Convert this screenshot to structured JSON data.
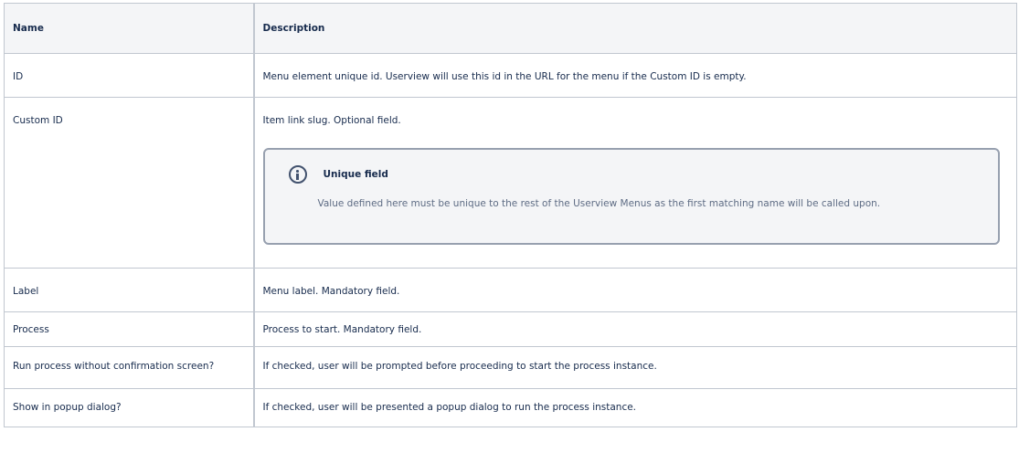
{
  "table": {
    "headers": {
      "name": "Name",
      "description": "Description"
    },
    "rows": [
      {
        "name": "ID",
        "description": "Menu element unique id. Userview will use this id in the URL for the menu if the Custom ID is empty."
      },
      {
        "name": "Custom ID",
        "description": "Item link slug. Optional field.",
        "panel": {
          "icon": "info-icon",
          "title": "Unique field",
          "body": "Value defined here must be unique to the rest of the Userview Menus as the first matching name will be called upon."
        }
      },
      {
        "name": "Label",
        "description": "Menu label. Mandatory field."
      },
      {
        "name": "Process",
        "description": "Process to start. Mandatory field."
      },
      {
        "name": "Run process without confirmation screen?",
        "description": "If checked, user will be prompted before proceeding to start the process instance."
      },
      {
        "name": "Show in popup dialog?",
        "description": "If checked, user will be presented a popup dialog to run the process instance."
      }
    ]
  },
  "colors": {
    "border": "#c1c7d0",
    "header_bg": "#f4f5f7",
    "panel_border": "#97a0af",
    "text": "#172b4d"
  }
}
